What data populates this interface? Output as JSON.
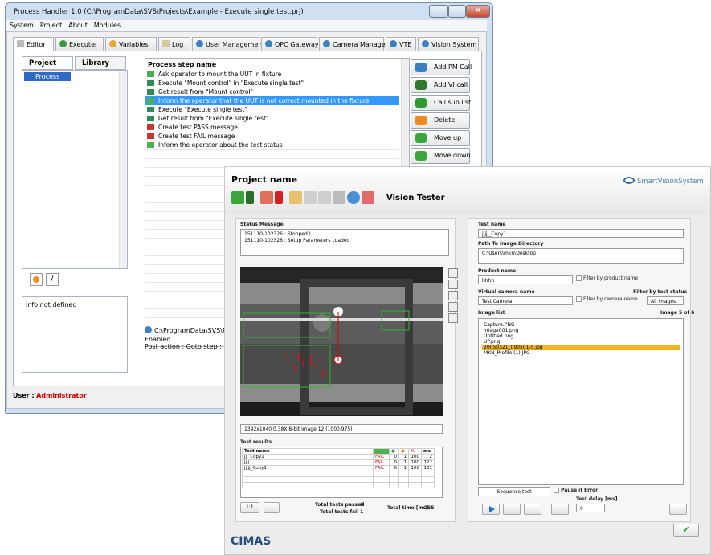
{
  "back_window": {
    "title": "Process Handler 1.0 (C:\\ProgramData\\SVS\\Projects\\Example - Execute single test.prj)",
    "menu": [
      "System",
      "Project",
      "About",
      "Modules"
    ],
    "tabs": [
      "Editor",
      "Executer",
      "Variables",
      "Log",
      "User Management",
      "OPC Gateway",
      "Camera Manager",
      "VTE",
      "Vision System"
    ],
    "subtabs": [
      "Project",
      "Library"
    ],
    "tree_item": "Process loop",
    "info_text": "Info not defined",
    "steps_header": "Process step name",
    "steps": [
      "Ask operator to mount the UUT in fixture",
      "Execute \"Mount control\" in \"Execute single test\"",
      "Get result from \"Mount control\"",
      "Inform the operator that the UUT is not correct mounted in the fixture",
      "Execute \"Execute single test\"",
      "Get result from \"Execute single test\"",
      "Create test PASS message",
      "Create test FAIL message",
      "Inform the operator about the test status"
    ],
    "selected_step": 3,
    "side_buttons": [
      "Add PM Call",
      "Add VI call",
      "Call sub list",
      "Delete",
      "Move up",
      "Move down"
    ],
    "path_text": "C:\\ProgramData\\SVS\\Pro",
    "enabled_text": "Enabled",
    "post_action_text": "Post action : Goto step : On T",
    "user_label": "User :",
    "user_name": "Administrator"
  },
  "front_window": {
    "project_name": "Project name",
    "logo_text": "SmartVisionSystem",
    "vision_tester": "Vision Tester",
    "status_label": "Status Message",
    "status_lines": [
      "151110-102326 : Stopped !",
      "151110-102326 : Setup Parameters Loaded"
    ],
    "image_info": "1392x1040 0.38X 8-bit image 12   (1000,975)",
    "test_results_label": "Test results",
    "results_header": [
      "Test name",
      "%",
      "ms"
    ],
    "results_rows": [
      {
        "name": "jjj_Copy1",
        "status": "FAIL",
        "ok": "0",
        "err": "1",
        "pct": "100",
        "ms": "2"
      },
      {
        "name": "jjjj",
        "status": "FAIL",
        "ok": "0",
        "err": "1",
        "pct": "100",
        "ms": "122"
      },
      {
        "name": "jjjjj_Copy1",
        "status": "FAIL",
        "ok": "0",
        "err": "1",
        "pct": "100",
        "ms": "131"
      }
    ],
    "total_passed_label": "Total tests passed",
    "total_passed": "0",
    "total_fail_label": "Total tests fail",
    "total_fail": "1",
    "total_time_label": "Total time [ms]",
    "total_time": "255",
    "test_name_label": "Test name",
    "test_name_value": "jjjjj_Copy1",
    "path_label": "Path To Image Directory",
    "path_value": "C:\\Users\\mkn\\Desktop",
    "product_label": "Product name",
    "product_value": "hhhh",
    "filter_product": "Filter by product name",
    "vcam_label": "Virtual camera name",
    "vcam_value": "Test Camera",
    "filter_camera": "Filter by camera name",
    "filter_status_label": "Filter by test status",
    "filter_status_value": "All images",
    "image_list_label": "Image list",
    "image_count": "Image 5 of 6",
    "images": [
      "Capture.PNG",
      "image001.png",
      "Untitled.png",
      "UP.png",
      "20050321_090501-5.jpg",
      "MKN_Profile (1).JPG"
    ],
    "selected_image": 4,
    "sequence_label": "Sequence test",
    "pause_label": "Pause if Error",
    "delay_label": "Test delay [ms]",
    "delay_value": "0",
    "zoom_label": "1:1",
    "footer_brand": "CIMAS"
  }
}
